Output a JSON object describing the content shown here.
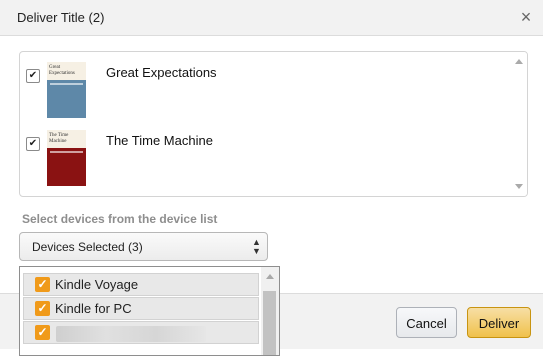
{
  "dialog": {
    "title": "Deliver Title (2)",
    "close_icon": "close-icon"
  },
  "titles": [
    {
      "label": "Great Expectations",
      "checked": true,
      "cover_text": "Great Expectations",
      "cover_color": "#5e88a8"
    },
    {
      "label": "The Time Machine",
      "checked": true,
      "cover_text": "The Time Machine",
      "cover_color": "#8a1212"
    }
  ],
  "devices": {
    "section_label": "Select devices from the device list",
    "select_value": "Devices Selected (3)",
    "options": [
      {
        "label": "Kindle Voyage",
        "checked": true
      },
      {
        "label": "Kindle for PC",
        "checked": true
      },
      {
        "label": "",
        "checked": true,
        "redacted": true
      }
    ]
  },
  "footer": {
    "cancel_label": "Cancel",
    "deliver_label": "Deliver"
  },
  "colors": {
    "deliver_button": "#f0c14b",
    "checkbox_accent": "#f09a1a",
    "section_label": "#8e8e8e"
  }
}
